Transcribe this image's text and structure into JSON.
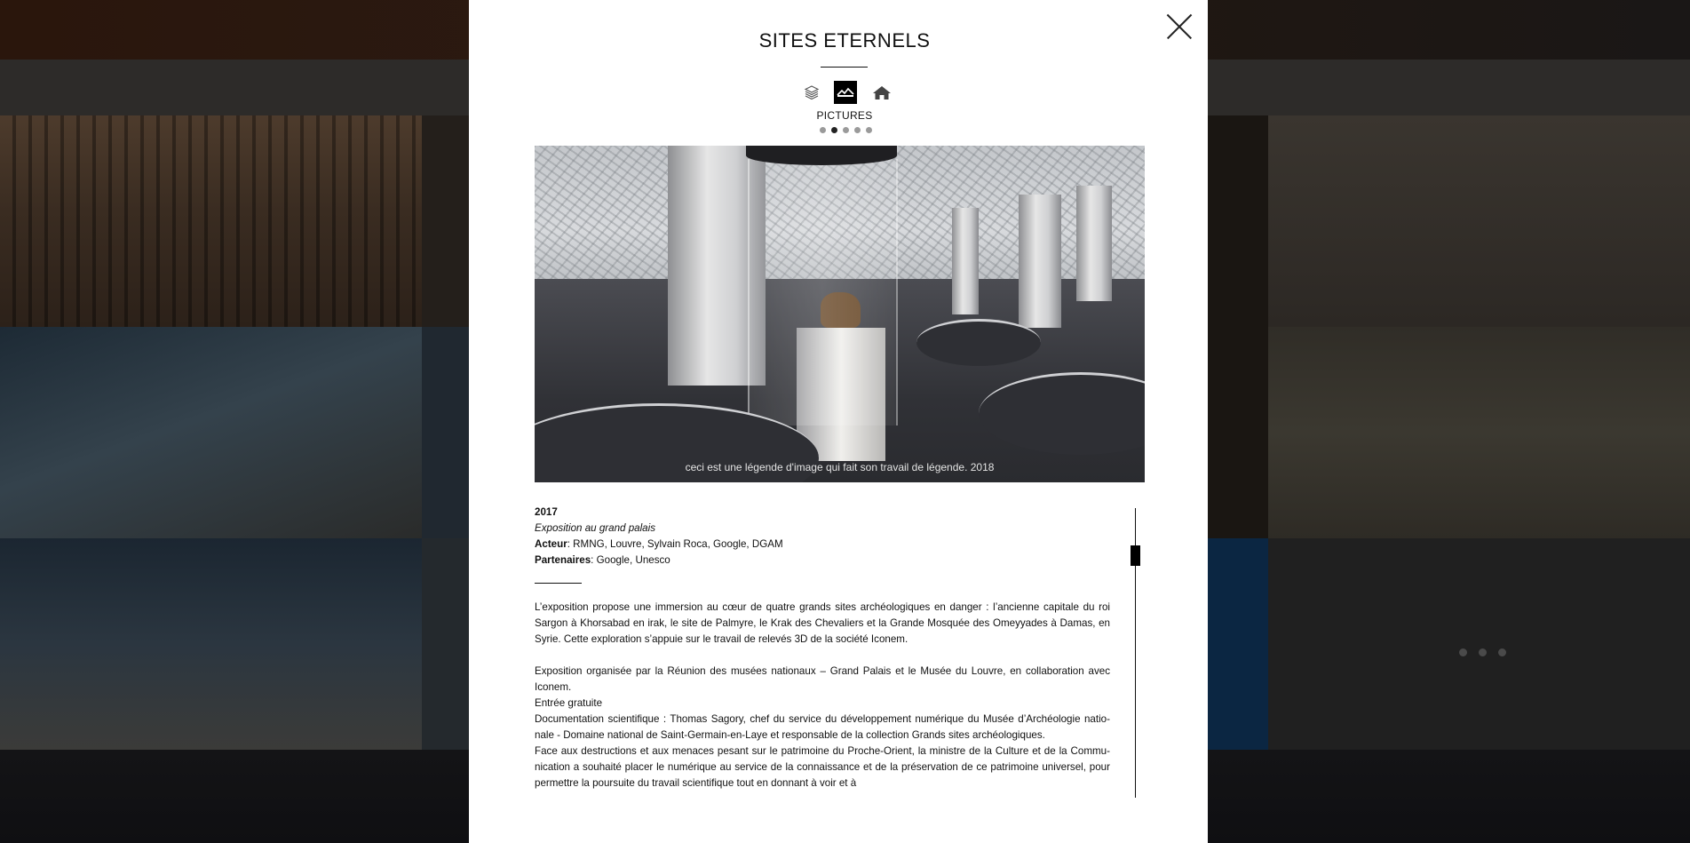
{
  "modal": {
    "title": "SITES ETERNELS",
    "icons": [
      "layers-icon",
      "pictures-icon",
      "home-icon"
    ],
    "active_section": "PICTURES",
    "slides_total": 5,
    "slide_active": 2
  },
  "image": {
    "caption": "ceci est une légende d'image qui fait son travail de légende. 2018"
  },
  "details": {
    "year": "2017",
    "subtitle": "Exposition au grand palais",
    "actor_label": "Acteur",
    "actor_value": ": RMNG, Louvre, Sylvain Roca, Google, DGAM",
    "partners_label": "Partenaires",
    "partners_value": ": Google, Unesco"
  },
  "body": {
    "p1": "L’exposition propose une immersion au cœur de quatre grands sites archéologiques en danger : l’ancienne capitale du roi Sargon à Khorsabad en irak, le site de Palmyre, le Krak des Chevaliers et la Grande Mosquée des Omeyyades à Damas, en Syrie. Cette exploration s’appuie sur le travail de relevés 3D de la société Iconem.",
    "p2": "Exposition organisée par la Réunion des musées nationaux – Grand Palais et le Musée du Louvre, en collaboration avec Iconem.",
    "p3": "Entrée gratuite",
    "p4": "Documentation scientifique : Thomas Sagory, chef du service du développement numérique du Musée d’Archéologie natio-nale - Domaine national de Saint-Germain-en-Laye et responsable de la collection Grands sites archéologiques.",
    "p5": "Face aux destructions et aux menaces pesant sur le patrimoine du Proche-Orient, la ministre de la Culture et de la Commu-nication a souhaité placer le numérique au service de la connaissance et de la préservation de ce patrimoine universel, pour permettre la poursuite du travail scientifique tout en donnant à voir et à"
  },
  "colors": {
    "overlay": "#1a1612",
    "modal_bg": "#ffffff",
    "text": "#111111",
    "accent_tile": "#0b2642"
  }
}
